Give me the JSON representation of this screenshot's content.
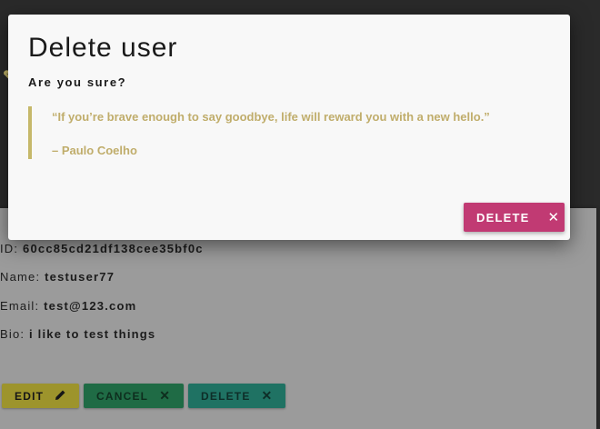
{
  "dialog": {
    "title": "Delete user",
    "subtitle": "Are you sure?",
    "quote": "“If you’re brave enough to say goodbye, life will reward you with a new hello.”",
    "quote_author": "– Paulo Coelho",
    "delete_label": "DELETE"
  },
  "user": {
    "id_label": "ID: ",
    "id_value": "60cc85cd21df138cee35bf0c",
    "name_label": "Name: ",
    "name_value": "testuser77",
    "email_label": "Email: ",
    "email_value": "test@123.com",
    "bio_label": "Bio: ",
    "bio_value": "i like to test things"
  },
  "actions": {
    "edit_label": "EDIT",
    "cancel_label": "CANCEL",
    "delete_label": "DELETE"
  },
  "icons": {
    "edit": "pencil-icon",
    "cancel": "close-icon",
    "delete": "close-icon"
  },
  "colors": {
    "modal_delete": "#c13a73",
    "quote_accent": "#c6b86a",
    "edit": "#9d942c",
    "cancel": "#1f6b45",
    "delete": "#1f7263"
  }
}
